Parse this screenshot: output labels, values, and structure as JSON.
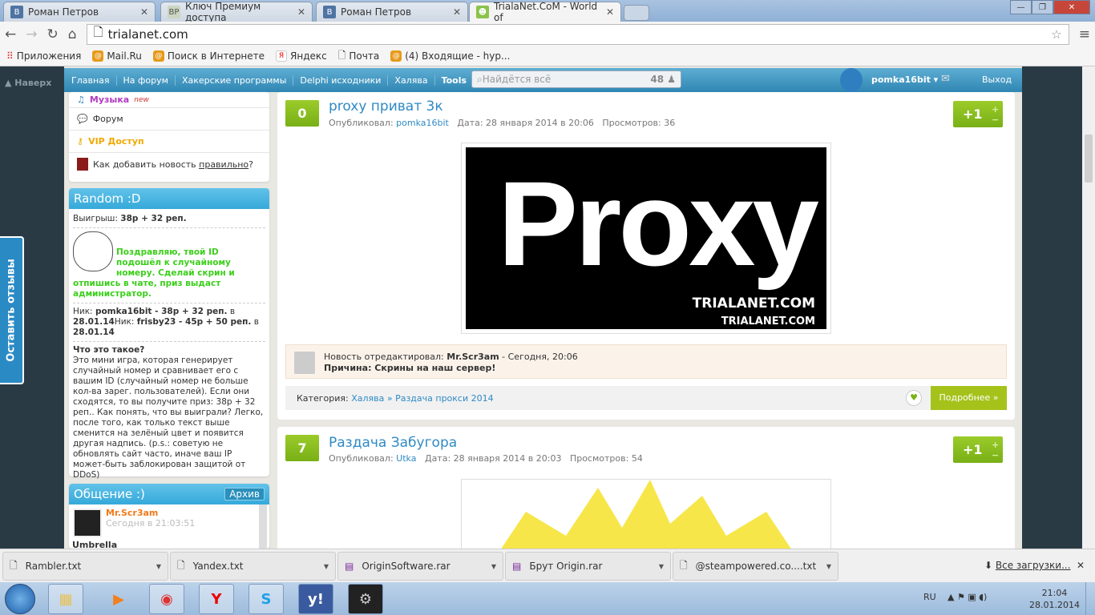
{
  "browser": {
    "tabs": [
      {
        "label": "Роман Петров",
        "icon": "В"
      },
      {
        "label": "Ключ Премиум доступа",
        "icon": "BP"
      },
      {
        "label": "Роман Петров",
        "icon": "В"
      },
      {
        "label": "TrialaNet.CoM - World of",
        "icon": "☻"
      }
    ],
    "url": "trialanet.com",
    "bookmarks": [
      "Приложения",
      "Mail.Ru",
      "Поиск в Интернете",
      "Яндекс",
      "Почта",
      "(4) Входящие - hyp..."
    ]
  },
  "site": {
    "back_to_top": "Наверх",
    "nav": [
      "Главная",
      "На форум",
      "Хакерские программы",
      "Delphi исходники",
      "Халява",
      "Tools"
    ],
    "search_placeholder": "Найдётся всё",
    "online_count": "48",
    "username": "pomka16bit",
    "logout": "Выход",
    "feedback": "Оставить отзывы"
  },
  "sidebar": {
    "menu": [
      {
        "label": "Музыка",
        "badge": "new"
      },
      {
        "label": "Форум"
      },
      {
        "label": "VIP Доступ"
      },
      {
        "label": "Как добавить новость ",
        "link": "правильно",
        "suffix": "?"
      }
    ],
    "random": {
      "title": "Random :D",
      "win_label": "Выигрыш:",
      "win_value": "38р + 32 реп.",
      "congrats": "Поздравляю, твой ID подошёл к случайному номеру. Сделай скрин и отпишись в чате, приз выдаст администратор.",
      "winners": [
        {
          "label": "Ник:",
          "nick": "pomka16bit - 38р + 32 реп.",
          "in": "в",
          "date": "28.01.14"
        },
        {
          "label": "Ник:",
          "nick": "frisby23 - 45р + 50 реп.",
          "in": "в",
          "date": "28.01.14"
        }
      ],
      "what_title": "Что это такое?",
      "what_text": "Это мини игра, которая генерирует случайный номер и сравнивает его с вашим ID (случайный номер не больше кол-ва зарег. пользователей). Если они сходятся, то вы получите приз: 38р + 32 реп.. Как понять, что вы выиграли? Легко, после того, как только текст выше сменится на зелёный цвет и появится другая надпись. (p.s.: советую не обновлять сайт часто, иначе ваш IP может-быть заблокирован защитой от DDoS)"
    },
    "chat": {
      "title": "Общение :)",
      "archive": "Архив",
      "user": "Mr.Scr3am",
      "time": "Сегодня в 21:03:51",
      "message": "Umbrella"
    }
  },
  "posts": [
    {
      "score": "0",
      "title": "proxy приват 3к",
      "author_label": "Опубликовал:",
      "author": "pomka16bit",
      "date": "Дата: 28 января 2014 в 20:06",
      "views": "Просмотров: 36",
      "vote": "+1",
      "image_text": "Proxy",
      "watermark": "TRIALANET.COM",
      "edit_label": "Новость отредактировал:",
      "editor": "Mr.Scr3am",
      "edit_time": "- Сегодня, 20:06",
      "reason": "Причина: Скрины на наш сервер!",
      "category_label": "Категория:",
      "category": "Халява » Раздача прокси 2014",
      "more": "Подробнее »"
    },
    {
      "score": "7",
      "title": "Раздача Забугора",
      "author_label": "Опубликовал:",
      "author": "Utka",
      "date": "Дата: 28 января 2014 в 20:03",
      "views": "Просмотров: 54",
      "vote": "+1"
    }
  ],
  "downloads": {
    "files": [
      "Rambler.txt",
      "Yandex.txt",
      "OriginSoftware.rar",
      "Брут Origin.rar",
      "@steampowered.co....txt"
    ],
    "all": "Все загрузки..."
  },
  "taskbar": {
    "lang": "RU",
    "time": "21:04",
    "date": "28.01.2014"
  }
}
